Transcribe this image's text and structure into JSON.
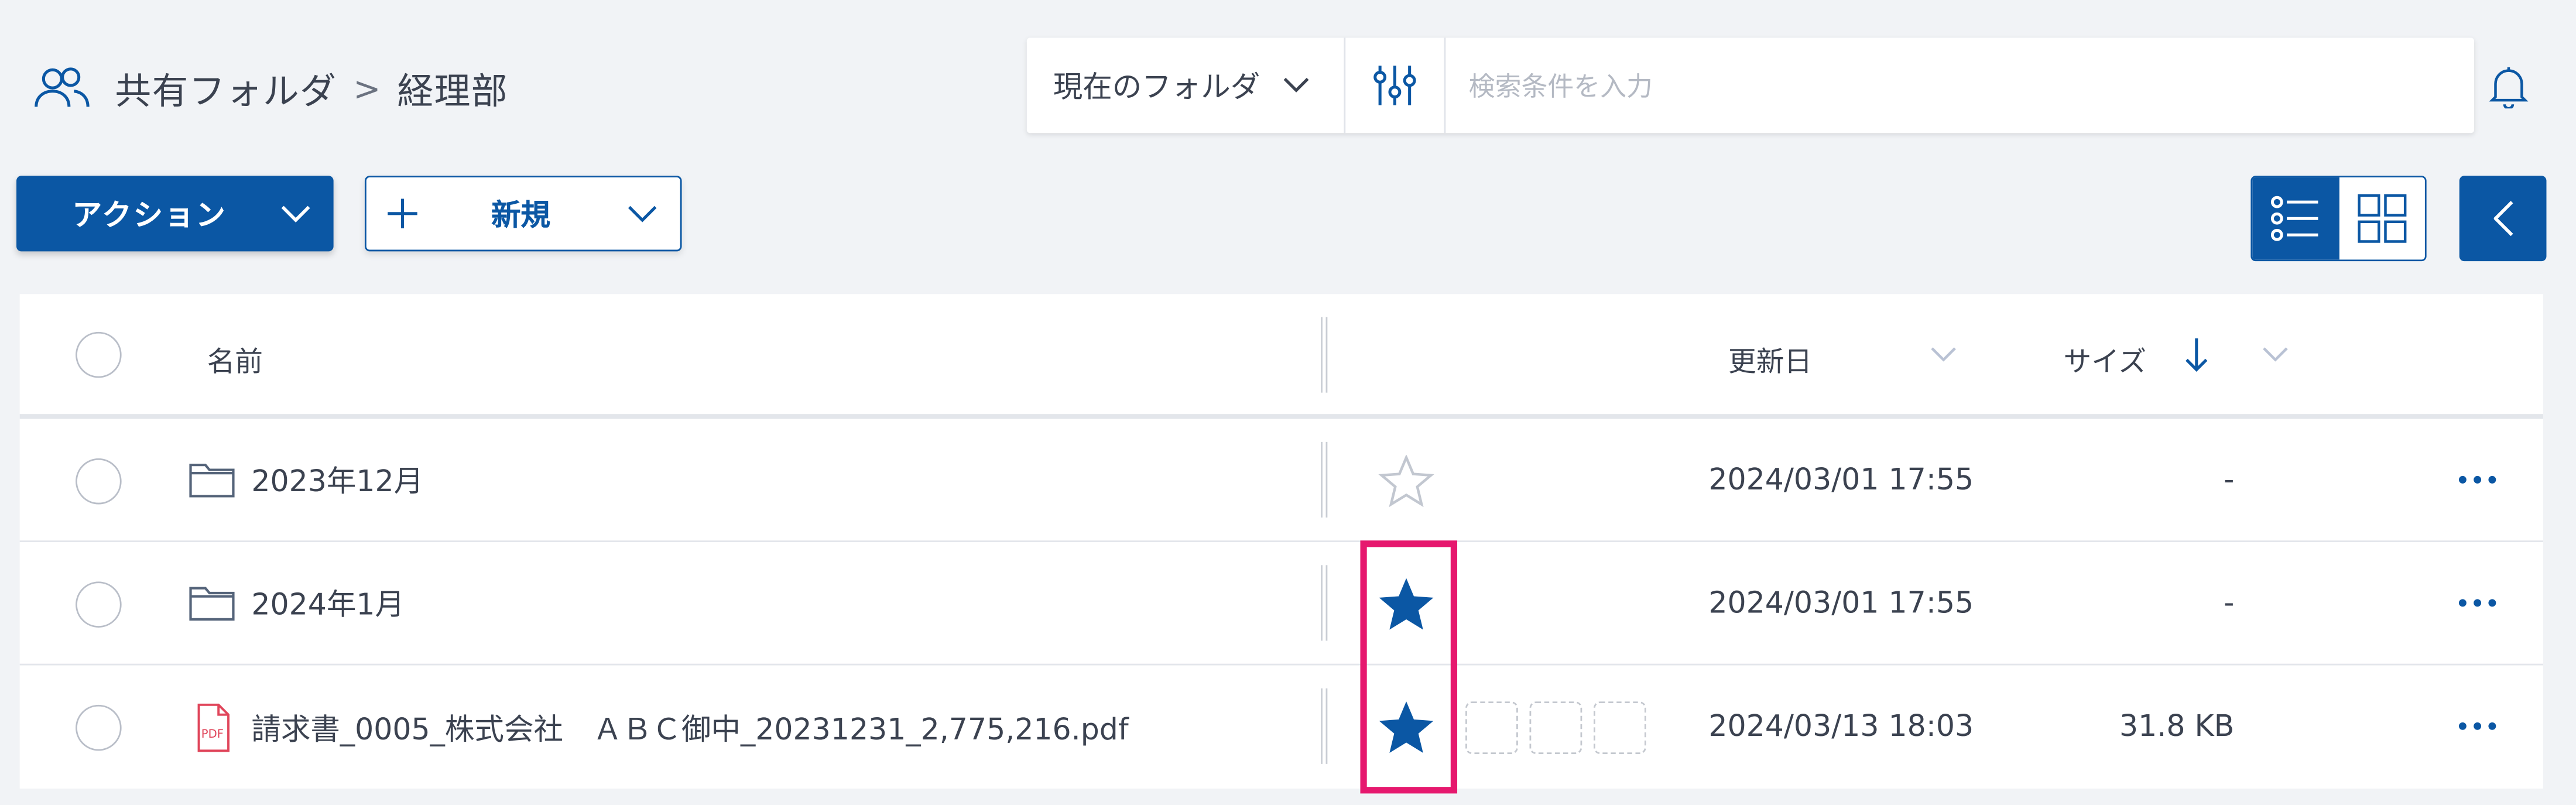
{
  "breadcrumb": {
    "icon": "users-icon",
    "parent": "共有フォルダ",
    "separator": ">",
    "current": "経理部"
  },
  "search": {
    "scope_label": "現在のフォルダ",
    "placeholder": "検索条件を入力",
    "value": ""
  },
  "toolbar": {
    "action_label": "アクション",
    "new_label": "新規"
  },
  "table": {
    "columns": {
      "name": "名前",
      "modified": "更新日",
      "size": "サイズ"
    },
    "rows": [
      {
        "type": "folder",
        "name": "2023年12月",
        "starred": false,
        "modified": "2024/03/01 17:55",
        "size": "-"
      },
      {
        "type": "folder",
        "name": "2024年1月",
        "starred": true,
        "modified": "2024/03/01 17:55",
        "size": "-"
      },
      {
        "type": "pdf",
        "name": "請求書_0005_株式会社　ＡＢＣ御中_20231231_2,775,216.pdf",
        "starred": true,
        "modified": "2024/03/13 18:03",
        "size": "31.8 KB"
      }
    ]
  },
  "colors": {
    "primary": "#0b57a4",
    "background": "#f1f3f6",
    "highlight": "#e6186e",
    "pdf": "#e0455a"
  }
}
